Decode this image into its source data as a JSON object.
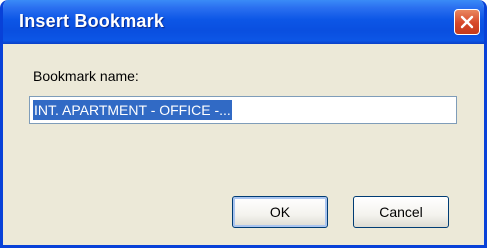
{
  "dialog": {
    "title": "Insert Bookmark",
    "close_icon": "close-icon"
  },
  "form": {
    "label": "Bookmark name:",
    "bookmark_name_value": "INT. APARTMENT - OFFICE -..."
  },
  "buttons": {
    "ok_label": "OK",
    "cancel_label": "Cancel"
  },
  "colors": {
    "titlebar": "#0a4fe0",
    "close_button": "#d7482a",
    "selection": "#316ac5",
    "dialog_background": "#ece9d8"
  }
}
